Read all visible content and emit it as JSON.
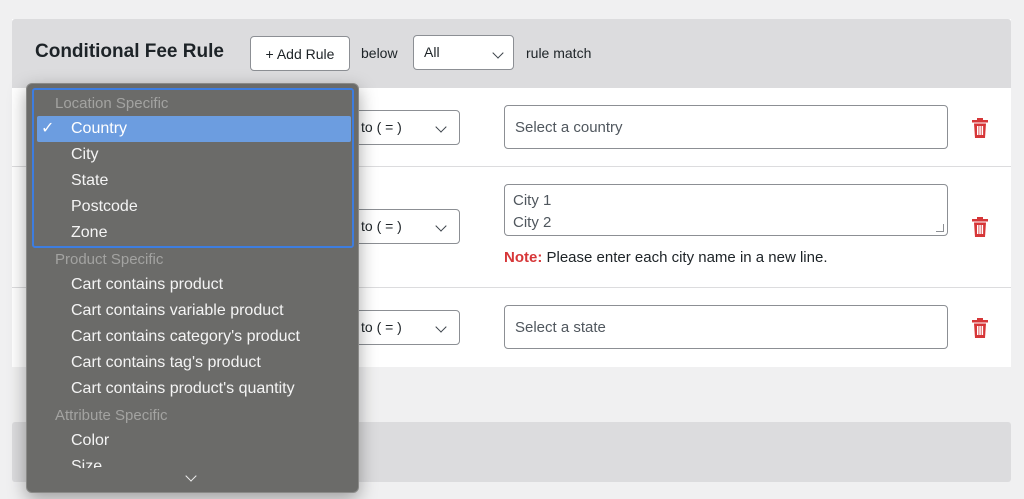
{
  "header": {
    "title": "Conditional Fee Rule",
    "add_rule_label": "+ Add Rule",
    "below_label": "below",
    "match_select_value": "All",
    "rule_match_label": "rule match"
  },
  "rows": [
    {
      "operator": "to ( = )",
      "value_placeholder": "Select a country"
    },
    {
      "operator": "to ( = )",
      "value_lines": [
        "City 1",
        "City 2"
      ],
      "note_label": "Note:",
      "note_text": "Please enter each city name in a new line."
    },
    {
      "operator": "to ( = )",
      "value_placeholder": "Select a state"
    }
  ],
  "dropdown": {
    "groups": [
      {
        "label": "Location Specific",
        "options": [
          "Country",
          "City",
          "State",
          "Postcode",
          "Zone"
        ]
      },
      {
        "label": "Product Specific",
        "options": [
          "Cart contains product",
          "Cart contains variable product",
          "Cart contains category's product",
          "Cart contains tag's product",
          "Cart contains product's quantity"
        ]
      },
      {
        "label": "Attribute Specific",
        "options": [
          "Color",
          "Size"
        ]
      }
    ],
    "selected": "Country",
    "check_glyph": "✓"
  },
  "colors": {
    "accent_blue": "#3d7de0",
    "selected_bg": "#6c9de0",
    "danger_red": "#d63638"
  },
  "icons": {
    "delete": "trash-icon",
    "select": "chevron-down-icon"
  }
}
